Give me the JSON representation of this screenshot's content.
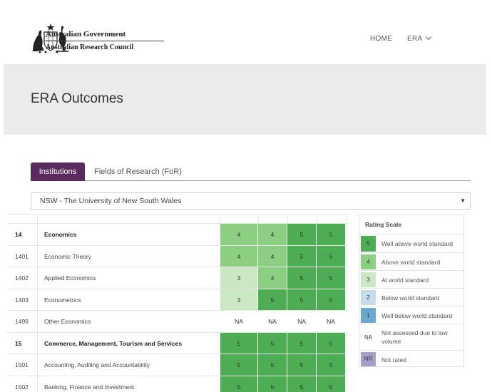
{
  "header": {
    "gov_name": "Australian Government",
    "arc_name": "Australian Research Council",
    "nav": [
      {
        "label": "HOME"
      },
      {
        "label": "ERA"
      }
    ]
  },
  "banner": {
    "title": "ERA Outcomes"
  },
  "tabs": [
    {
      "label": "Institutions",
      "active": true
    },
    {
      "label": "Fields of Research (FoR)",
      "active": false
    }
  ],
  "select": {
    "value": "NSW - The University of New South Wales",
    "caret": "▼"
  },
  "colors": {
    "r5": "#4cad55",
    "r4": "#8ccf83",
    "r3": "#cbe8c3",
    "r2": "#c5dcea",
    "r1": "#6ba8cf",
    "nr": "#a69fc8",
    "na": "#ffffff",
    "tab_active": "#5b2a5f"
  },
  "table": {
    "rows": [
      {
        "code": "14",
        "name": "Economics",
        "bold": true,
        "ratings": [
          "4",
          "4",
          "5",
          "5"
        ]
      },
      {
        "code": "1401",
        "name": "Economic Theory",
        "bold": false,
        "ratings": [
          "4",
          "4",
          "5",
          "5"
        ]
      },
      {
        "code": "1402",
        "name": "Applied Economics",
        "bold": false,
        "ratings": [
          "3",
          "4",
          "5",
          "5"
        ]
      },
      {
        "code": "1403",
        "name": "Econometrics",
        "bold": false,
        "ratings": [
          "3",
          "5",
          "5",
          "5"
        ]
      },
      {
        "code": "1499",
        "name": "Other Economics",
        "bold": false,
        "ratings": [
          "NA",
          "NA",
          "NA",
          "NA"
        ]
      },
      {
        "code": "15",
        "name": "Commerce, Management, Tourism and Services",
        "bold": true,
        "ratings": [
          "5",
          "5",
          "5",
          "5"
        ]
      },
      {
        "code": "1501",
        "name": "Accounting, Auditing and Accountability",
        "bold": false,
        "ratings": [
          "5",
          "5",
          "5",
          "5"
        ]
      },
      {
        "code": "1502",
        "name": "Banking, Finance and Investment",
        "bold": false,
        "ratings": [
          "5",
          "5",
          "5",
          "5"
        ]
      }
    ]
  },
  "legend": {
    "title": "Rating Scale",
    "items": [
      {
        "value": "5",
        "label": "Well above world standard",
        "color": "#4cad55"
      },
      {
        "value": "4",
        "label": "Above world standard",
        "color": "#8ccf83"
      },
      {
        "value": "3",
        "label": "At world standard",
        "color": "#cbe8c3"
      },
      {
        "value": "2",
        "label": "Below world standard",
        "color": "#c5dcea"
      },
      {
        "value": "1",
        "label": "Well below world standard",
        "color": "#6ba8cf"
      },
      {
        "value": "NA",
        "label": "Not assessed due to low volume",
        "color": "#ffffff"
      },
      {
        "value": "NR",
        "label": "Not rated",
        "color": "#a69fc8"
      }
    ]
  }
}
